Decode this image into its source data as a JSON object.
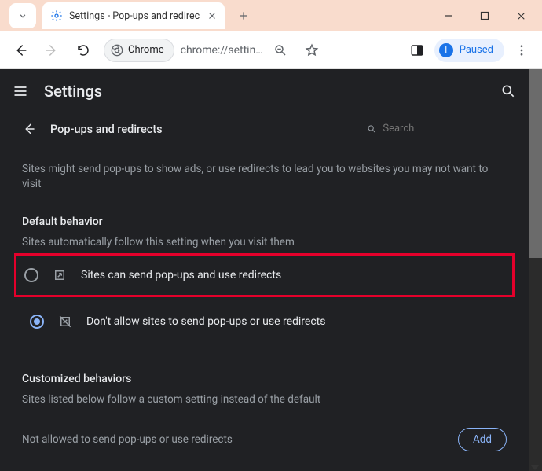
{
  "browser": {
    "tab_title": "Settings - Pop-ups and redirec",
    "chrome_label": "Chrome",
    "url": "chrome://settin…",
    "paused_initial": "I",
    "paused_label": "Paused"
  },
  "appbar": {
    "title": "Settings"
  },
  "subheader": {
    "title": "Pop-ups and redirects",
    "search_placeholder": "Search"
  },
  "intro": "Sites might send pop-ups to show ads, or use redirects to lead you to websites you may not want to visit",
  "default_behavior": {
    "title": "Default behavior",
    "subtitle": "Sites automatically follow this setting when you visit them",
    "options": [
      {
        "label": "Sites can send pop-ups and use redirects",
        "selected": false
      },
      {
        "label": "Don't allow sites to send pop-ups or use redirects",
        "selected": true
      }
    ]
  },
  "customized": {
    "title": "Customized behaviors",
    "subtitle": "Sites listed below follow a custom setting instead of the default",
    "not_allowed_label": "Not allowed to send pop-ups or use redirects",
    "add_label": "Add"
  }
}
